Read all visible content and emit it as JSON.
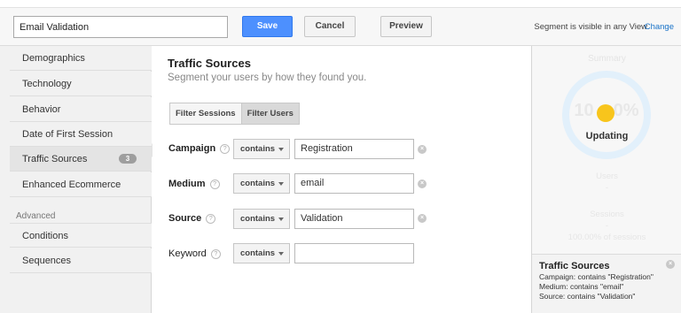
{
  "header": {
    "segment_name": "Email Validation",
    "save_label": "Save",
    "cancel_label": "Cancel",
    "preview_label": "Preview",
    "visibility_text": "Segment is visible in any View",
    "change_label": "Change"
  },
  "sidebar": {
    "items": [
      {
        "label": "Demographics"
      },
      {
        "label": "Technology"
      },
      {
        "label": "Behavior"
      },
      {
        "label": "Date of First Session"
      },
      {
        "label": "Traffic Sources",
        "badge": "3",
        "active": true
      },
      {
        "label": "Enhanced Ecommerce"
      }
    ],
    "advanced_label": "Advanced",
    "advanced_items": [
      {
        "label": "Conditions"
      },
      {
        "label": "Sequences"
      }
    ]
  },
  "main": {
    "title": "Traffic Sources",
    "subtitle": "Segment your users by how they found you.",
    "filter_sessions_label": "Filter Sessions",
    "filter_users_label": "Filter Users",
    "rows": [
      {
        "label": "Campaign",
        "help": "?",
        "operator": "contains",
        "value": "Registration"
      },
      {
        "label": "Medium",
        "help": "?",
        "operator": "contains",
        "value": "email"
      },
      {
        "label": "Source",
        "help": "?",
        "operator": "contains",
        "value": "Validation"
      },
      {
        "label": "Keyword",
        "help": "?",
        "operator": "contains",
        "value": ""
      }
    ],
    "clear_glyph": "×"
  },
  "summary": {
    "title": "Summary",
    "percent_left": "10",
    "percent_right": "0%",
    "status": "Updating",
    "users_label": "Users",
    "users_value": "-",
    "sessions_label": "Sessions",
    "sessions_value": "-",
    "sessions_pct": "100.00% of sessions",
    "info_title": "Traffic Sources",
    "info_lines": [
      "Campaign: contains \"Registration\"",
      "Medium: contains \"email\"",
      "Source: contains \"Validation\""
    ],
    "close_glyph": "×"
  },
  "colors": {
    "save_button": "#4d90fe",
    "link": "#1a73c8",
    "spinner": "#f8c51c"
  }
}
